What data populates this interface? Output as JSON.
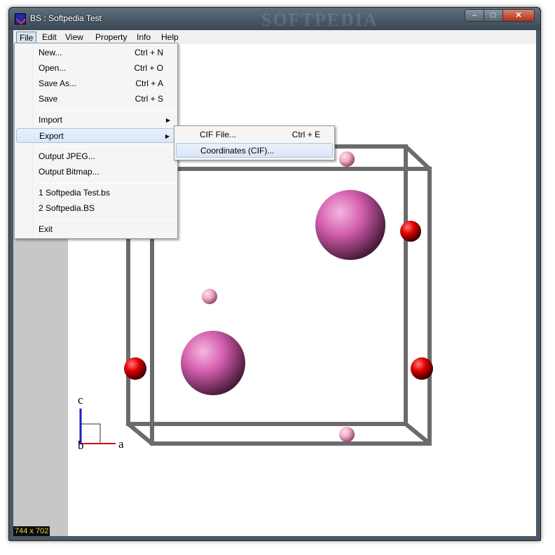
{
  "window": {
    "title": "BS  : Softpedia Test",
    "watermark": "SOFTPEDIA"
  },
  "title_buttons": {
    "minimize": "–",
    "maximize": "□",
    "close": "✕"
  },
  "menubar": {
    "file": "File",
    "edit": "Edit",
    "view": "View",
    "property": "Property",
    "info": "Info",
    "help": "Help"
  },
  "file_menu": {
    "new": {
      "label": "New...",
      "shortcut": "Ctrl + N"
    },
    "open": {
      "label": "Open...",
      "shortcut": "Ctrl + O"
    },
    "save_as": {
      "label": "Save As...",
      "shortcut": "Ctrl + A"
    },
    "save": {
      "label": "Save",
      "shortcut": "Ctrl + S"
    },
    "import": {
      "label": "Import"
    },
    "export": {
      "label": "Export"
    },
    "output_jpeg": {
      "label": "Output JPEG..."
    },
    "output_bitmap": {
      "label": "Output Bitmap..."
    },
    "recent1": {
      "label": "1  Softpedia Test.bs"
    },
    "recent2": {
      "label": "2  Softpedia.BS"
    },
    "exit": {
      "label": "Exit"
    }
  },
  "export_menu": {
    "cif_file": {
      "label": "CIF File...",
      "shortcut": "Ctrl + E"
    },
    "coordinates_cif": {
      "label": "Coordinates (CIF)..."
    }
  },
  "axes": {
    "c": "c",
    "a": "a",
    "b": "b"
  },
  "status": {
    "size": "744 x 702"
  },
  "colors": {
    "cell_edge": "#6b6b6b",
    "atom_large": "#d45fae",
    "atom_small": "#f2a5c6",
    "atom_red": "#e00000",
    "axis_c": "#1c1cc8",
    "axis_a": "#d01010"
  }
}
